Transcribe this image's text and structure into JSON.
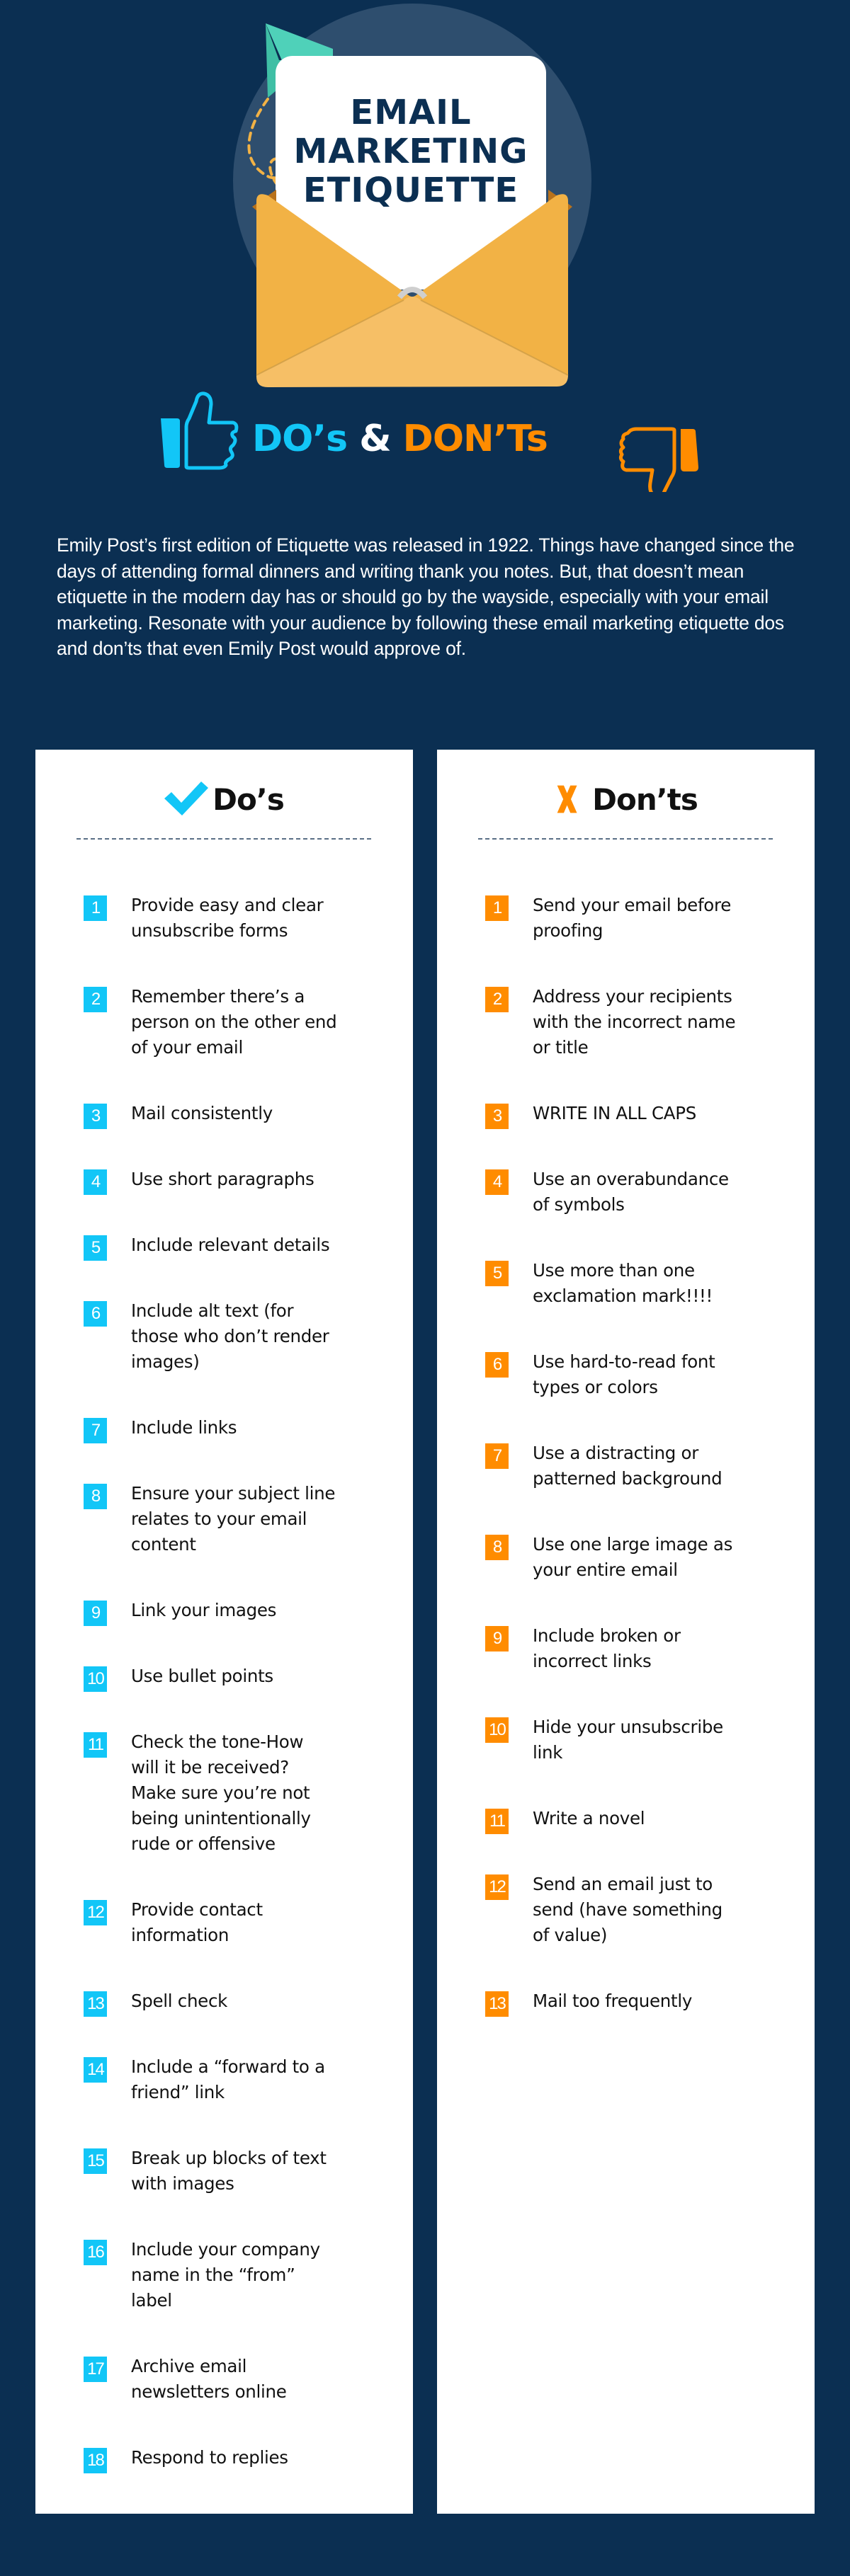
{
  "hero": {
    "title_lines": [
      "EMAIL",
      "MARKETING",
      "ETIQUETTE"
    ]
  },
  "banner": {
    "dos": "DO’s",
    "amp": "&",
    "donts": "DON’Ts"
  },
  "intro": "Emily Post’s first edition of Etiquette was released in 1922. Things have changed since the days of attending formal dinners and writing thank you notes. But, that doesn’t mean etiquette in the modern day has or should go by the wayside, especially with your email marketing. Resonate with your audience by following these email marketing etiquette dos and don’ts that even Emily Post would approve of.",
  "colors": {
    "background": "#0b2f52",
    "do_accent": "#12c6f7",
    "dont_accent": "#ff8c00",
    "envelope": "#f2b245",
    "plane": "#4fd1b9"
  },
  "dos": {
    "title": "Do’s",
    "icon": "check-icon",
    "items": [
      {
        "num": "1",
        "text": "Provide easy and clear\nunsubscribe forms"
      },
      {
        "num": "2",
        "text": "Remember there’s a\nperson on the other end\nof your email"
      },
      {
        "num": "3",
        "text": "Mail consistently"
      },
      {
        "num": "4",
        "text": "Use short paragraphs"
      },
      {
        "num": "5",
        "text": "Include relevant details"
      },
      {
        "num": "6",
        "text": "Include alt text (for\nthose who don’t render\nimages)"
      },
      {
        "num": "7",
        "text": "Include links"
      },
      {
        "num": "8",
        "text": "Ensure your subject line\nrelates to your email\ncontent"
      },
      {
        "num": "9",
        "text": "Link your images"
      },
      {
        "num": "10",
        "text": "Use bullet points"
      },
      {
        "num": "11",
        "text": "Check the tone-How\nwill it be received?\nMake sure you’re not\nbeing unintentionally\nrude or offensive"
      },
      {
        "num": "12",
        "text": "Provide contact\ninformation"
      },
      {
        "num": "13",
        "text": "Spell check"
      },
      {
        "num": "14",
        "text": "Include a “forward to a\nfriend” link"
      },
      {
        "num": "15",
        "text": "Break up blocks of text\nwith images"
      },
      {
        "num": "16",
        "text": "Include your company\nname in the “from”\nlabel"
      },
      {
        "num": "17",
        "text": "Archive email\nnewsletters online"
      },
      {
        "num": "18",
        "text": "Respond to replies"
      }
    ]
  },
  "donts": {
    "title": "Don’ts",
    "icon": "x-icon",
    "items": [
      {
        "num": "1",
        "text": "Send your email before\nproofing"
      },
      {
        "num": "2",
        "text": "Address your recipients\nwith the incorrect name\nor title"
      },
      {
        "num": "3",
        "text": "WRITE IN ALL CAPS"
      },
      {
        "num": "4",
        "text": "Use an overabundance\nof symbols"
      },
      {
        "num": "5",
        "text": "Use more than one\nexclamation mark!!!!"
      },
      {
        "num": "6",
        "text": "Use hard-to-read font\ntypes or colors"
      },
      {
        "num": "7",
        "text": "Use a distracting or\npatterned background"
      },
      {
        "num": "8",
        "text": "Use one large image as\nyour entire email"
      },
      {
        "num": "9",
        "text": "Include broken or\nincorrect links"
      },
      {
        "num": "10",
        "text": "Hide your unsubscribe\nlink"
      },
      {
        "num": "11",
        "text": "Write a novel"
      },
      {
        "num": "12",
        "text": "Send an email just to\nsend (have something\nof value)"
      },
      {
        "num": "13",
        "text": "Mail too frequently"
      }
    ]
  }
}
